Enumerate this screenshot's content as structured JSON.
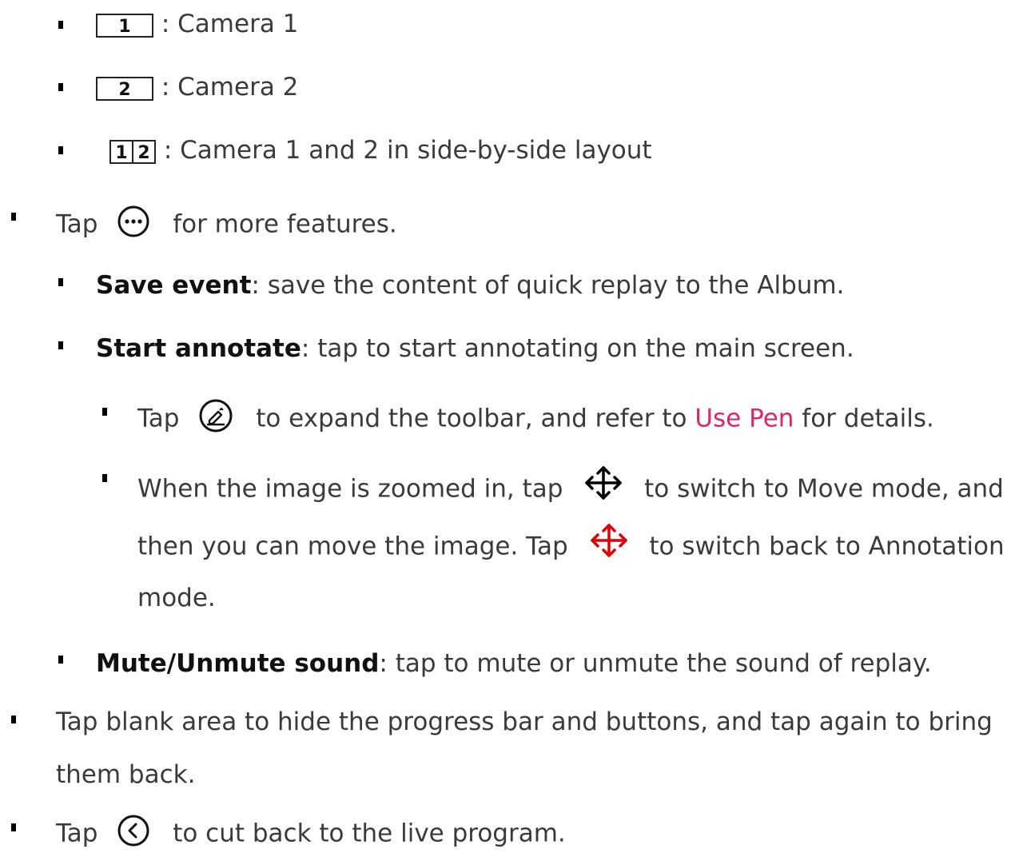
{
  "items": {
    "cam1": {
      "key": "1",
      "text": ": Camera 1"
    },
    "cam2": {
      "key": "2",
      "text": ": Camera 2"
    },
    "cam12": {
      "key_left": "1",
      "key_right": "2",
      "text": ": Camera 1 and 2 in side-by-side layout"
    },
    "more": {
      "pre": "Tap",
      "icon": "more-circle-icon",
      "post": "for more features."
    },
    "save_event": {
      "label": "Save event",
      "text": ": save the content of quick replay to the Album."
    },
    "start_annotate": {
      "label": "Start annotate",
      "text": ": tap to start annotating on the main screen."
    },
    "pen": {
      "pre": "Tap",
      "icon": "pen-circle-icon",
      "mid": "to expand the toolbar, and refer to",
      "link": "Use Pen",
      "post": "for details."
    },
    "move": {
      "line1_pre": "When the image is zoomed in, tap",
      "icon_black": "move-arrows-icon",
      "line1_post": "to switch to Move mode, and",
      "line2_pre": "then you can move the image. Tap",
      "icon_red": "move-arrows-red-icon",
      "line2_post": "to switch back to Annotation",
      "line3": "mode."
    },
    "mute": {
      "label": "Mute/Unmute sound",
      "text": ": tap to mute or unmute the sound of replay."
    },
    "blank": {
      "line1": "Tap blank area to hide the progress bar and buttons, and tap again to bring",
      "line2": "them back."
    },
    "back": {
      "pre": "Tap",
      "icon": "back-circle-icon",
      "post": "to cut back to the live program."
    }
  },
  "colors": {
    "text": "#3a3a3a",
    "link": "#e0246b",
    "move_red": "#e00000"
  }
}
